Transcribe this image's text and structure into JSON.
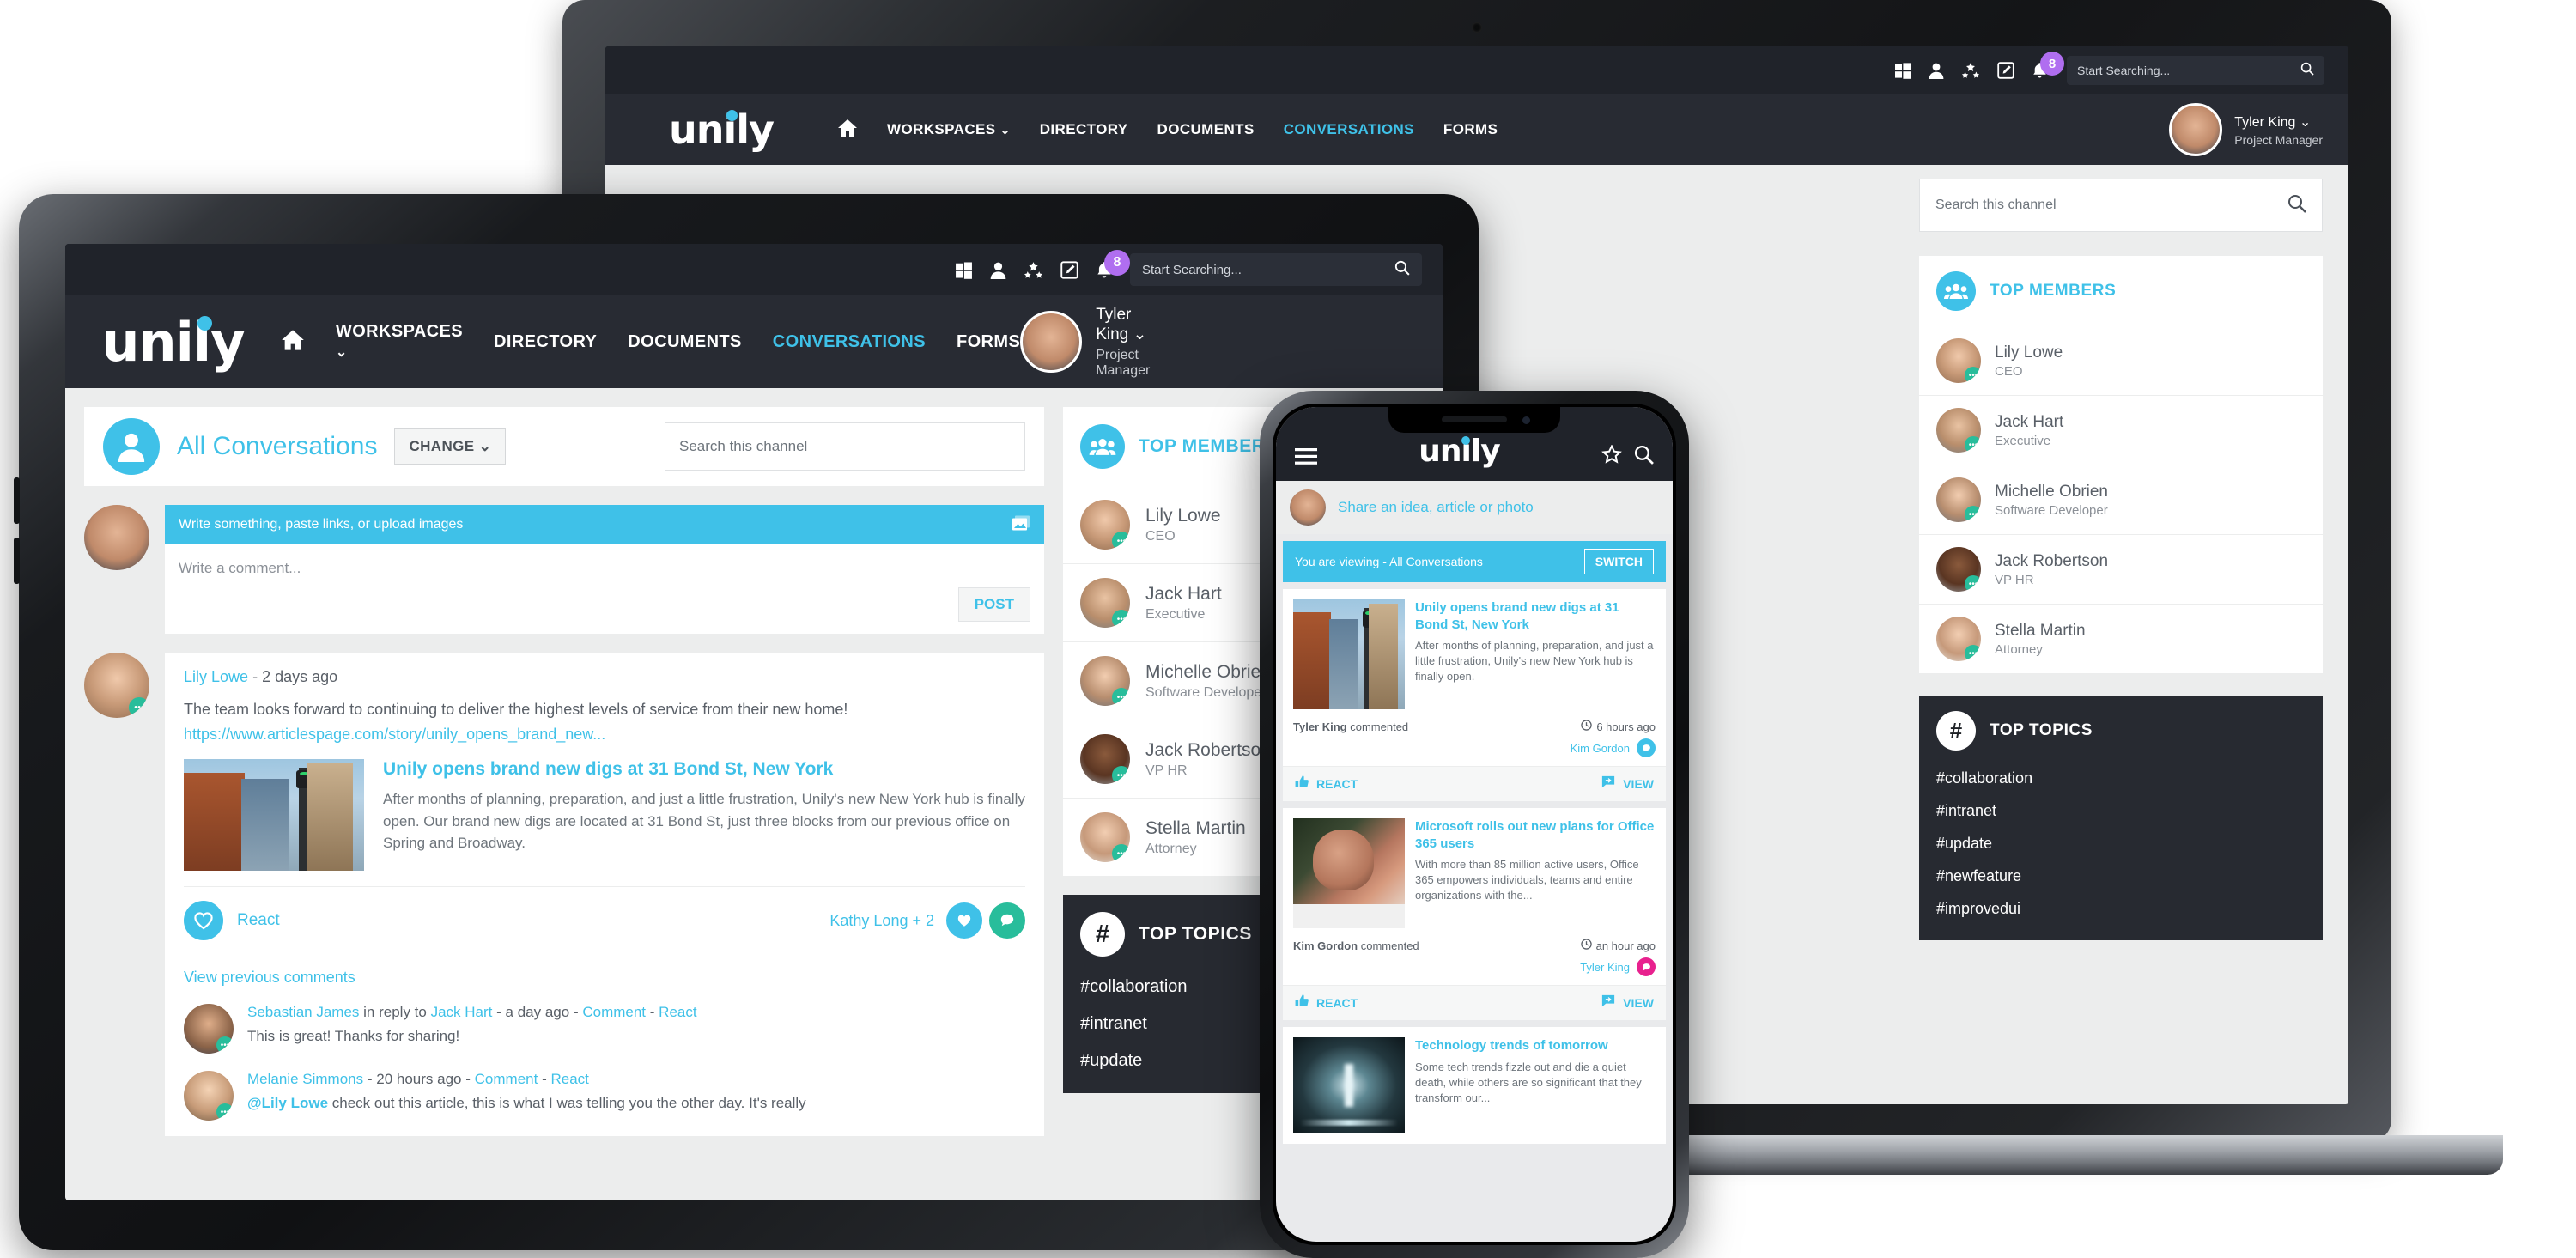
{
  "brand": {
    "name": "unily",
    "accent": "#3fc1e8",
    "dark": "#20232a",
    "badge_color": "#b06ef0"
  },
  "topbar": {
    "icons": [
      "windows-icon",
      "user-icon",
      "apps-icon",
      "compose-icon",
      "bell-icon"
    ],
    "notification_count": "8",
    "search_placeholder": "Start Searching...",
    "search_icon": "search-icon"
  },
  "nav": {
    "home_icon": "home-icon",
    "links": [
      {
        "label": "WORKSPACES",
        "active": false,
        "caret": true
      },
      {
        "label": "DIRECTORY",
        "active": false,
        "caret": false
      },
      {
        "label": "DOCUMENTS",
        "active": false,
        "caret": false
      },
      {
        "label": "CONVERSATIONS",
        "active": true,
        "caret": false
      },
      {
        "label": "FORMS",
        "active": false,
        "caret": false
      }
    ],
    "user": {
      "name": "Tyler King",
      "role": "Project Manager",
      "caret": "chevron-down-icon"
    }
  },
  "channel": {
    "title": "All Conversations",
    "change_label": "CHANGE",
    "change_caret": "chevron-down-icon",
    "avatar_icon": "person-icon",
    "search_placeholder": "Search this channel",
    "search_icon": "search-icon"
  },
  "composer": {
    "prompt": "Write something, paste links, or upload images",
    "image_icon": "image-upload-icon",
    "comment_placeholder": "Write a comment...",
    "post_label": "POST"
  },
  "post": {
    "author": "Lily Lowe",
    "separator": "-",
    "time": "2 days ago",
    "body": "The team looks forward to continuing to deliver the highest levels of service from their new home!",
    "link": "https://www.articlespage.com/story/unily_opens_brand_new...",
    "article_title": "Unily opens brand new digs at 31 Bond St, New York",
    "article_text": "After months of planning, preparation, and just a little frustration, Unily's new New York hub is finally open. Our brand new digs are located at 31 Bond St, just three blocks from our previous office on Spring and Broadway.",
    "react_label": "React",
    "react_icon": "heart-icon",
    "reactors": "Kathy Long + 2",
    "reaction_heart_icon": "heart-icon",
    "reaction_comment_icon": "comment-icon",
    "view_previous": "View previous comments"
  },
  "comments": [
    {
      "author": "Sebastian James",
      "reply_prefix": "in reply to",
      "reply_to": "Jack Hart",
      "time": "a day ago",
      "comment_link": "Comment",
      "react_link": "React",
      "text": "This is great! Thanks for sharing!",
      "mention": ""
    },
    {
      "author": "Melanie Simmons",
      "reply_prefix": "",
      "reply_to": "",
      "time": "20 hours ago",
      "comment_link": "Comment",
      "react_link": "React",
      "mention": "@Lily Lowe",
      "text": "check out this article, this is what I was telling you the other day. It's really"
    }
  ],
  "top_members": {
    "title": "TOP MEMBERS",
    "icon": "people-icon",
    "items": [
      {
        "name": "Lily Lowe",
        "role": "CEO",
        "face": "face-f1"
      },
      {
        "name": "Jack Hart",
        "role": "Executive",
        "face": "face-m2"
      },
      {
        "name": "Michelle Obrien",
        "role": "Software Developer",
        "face": "face-f2"
      },
      {
        "name": "Jack Robertson",
        "role": "VP HR",
        "face": "face-m3"
      },
      {
        "name": "Stella Martin",
        "role": "Attorney",
        "face": "face-f3"
      }
    ]
  },
  "top_topics": {
    "title": "TOP TOPICS",
    "icon": "hash-icon",
    "items": [
      "#collaboration",
      "#intranet",
      "#update",
      "#newfeature",
      "#improvedui"
    ]
  },
  "phone": {
    "menu_icon": "hamburger-icon",
    "star_icon": "star-icon",
    "search_icon": "search-icon",
    "share_prompt": "Share an idea, article or photo",
    "viewing_label": "You are viewing - All Conversations",
    "switch_label": "SWITCH",
    "cards": [
      {
        "title": "Unily opens brand new digs at 31 Bond St, New York",
        "excerpt": "After months of planning, preparation, and just a little frustration, Unily's new New York hub is finally open.",
        "actor": "Tyler King",
        "action": "commented",
        "time": "6 hours ago",
        "time_icon": "clock-icon",
        "reactor": "Kim Gordon",
        "reactor_icon_color": "#3fc1e8",
        "react_label": "REACT",
        "react_icon": "thumbs-up-icon",
        "view_label": "VIEW",
        "view_icon": "comment-arrow-icon",
        "photo": "ph-street"
      },
      {
        "title": "Microsoft rolls out new plans for Office 365 users",
        "excerpt": "With more than 85 million active users, Office 365 empowers individuals, teams and entire organizations with the...",
        "actor": "Kim Gordon",
        "action": "commented",
        "time": "an hour ago",
        "time_icon": "clock-icon",
        "reactor": "Tyler King",
        "reactor_icon_color": "#e8218e",
        "react_label": "REACT",
        "react_icon": "thumbs-up-icon",
        "view_label": "VIEW",
        "view_icon": "comment-arrow-icon",
        "photo": "ph-woman"
      },
      {
        "title": "Technology trends of tomorrow",
        "excerpt": "Some tech trends fizzle out and die a quiet death, while others are so significant that they transform our...",
        "actor": "",
        "action": "",
        "time": "",
        "time_icon": "",
        "reactor": "",
        "reactor_icon_color": "",
        "react_label": "",
        "react_icon": "",
        "view_label": "",
        "view_icon": "",
        "photo": "ph-tunnel"
      }
    ]
  }
}
